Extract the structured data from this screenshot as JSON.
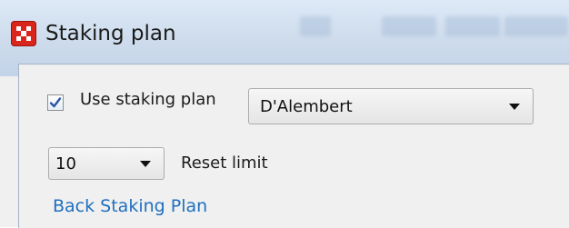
{
  "window": {
    "title": "Staking plan",
    "icon": "app-grid-icon",
    "accent_color": "#d9251c"
  },
  "form": {
    "use_plan_checkbox": {
      "label": "Use staking plan",
      "checked": true
    },
    "plan_select": {
      "selected": "D'Alembert"
    },
    "reset_limit": {
      "selected": "10",
      "label": "Reset limit"
    },
    "back_link": {
      "label": "Back Staking Plan",
      "color": "#1f6fbf"
    }
  }
}
